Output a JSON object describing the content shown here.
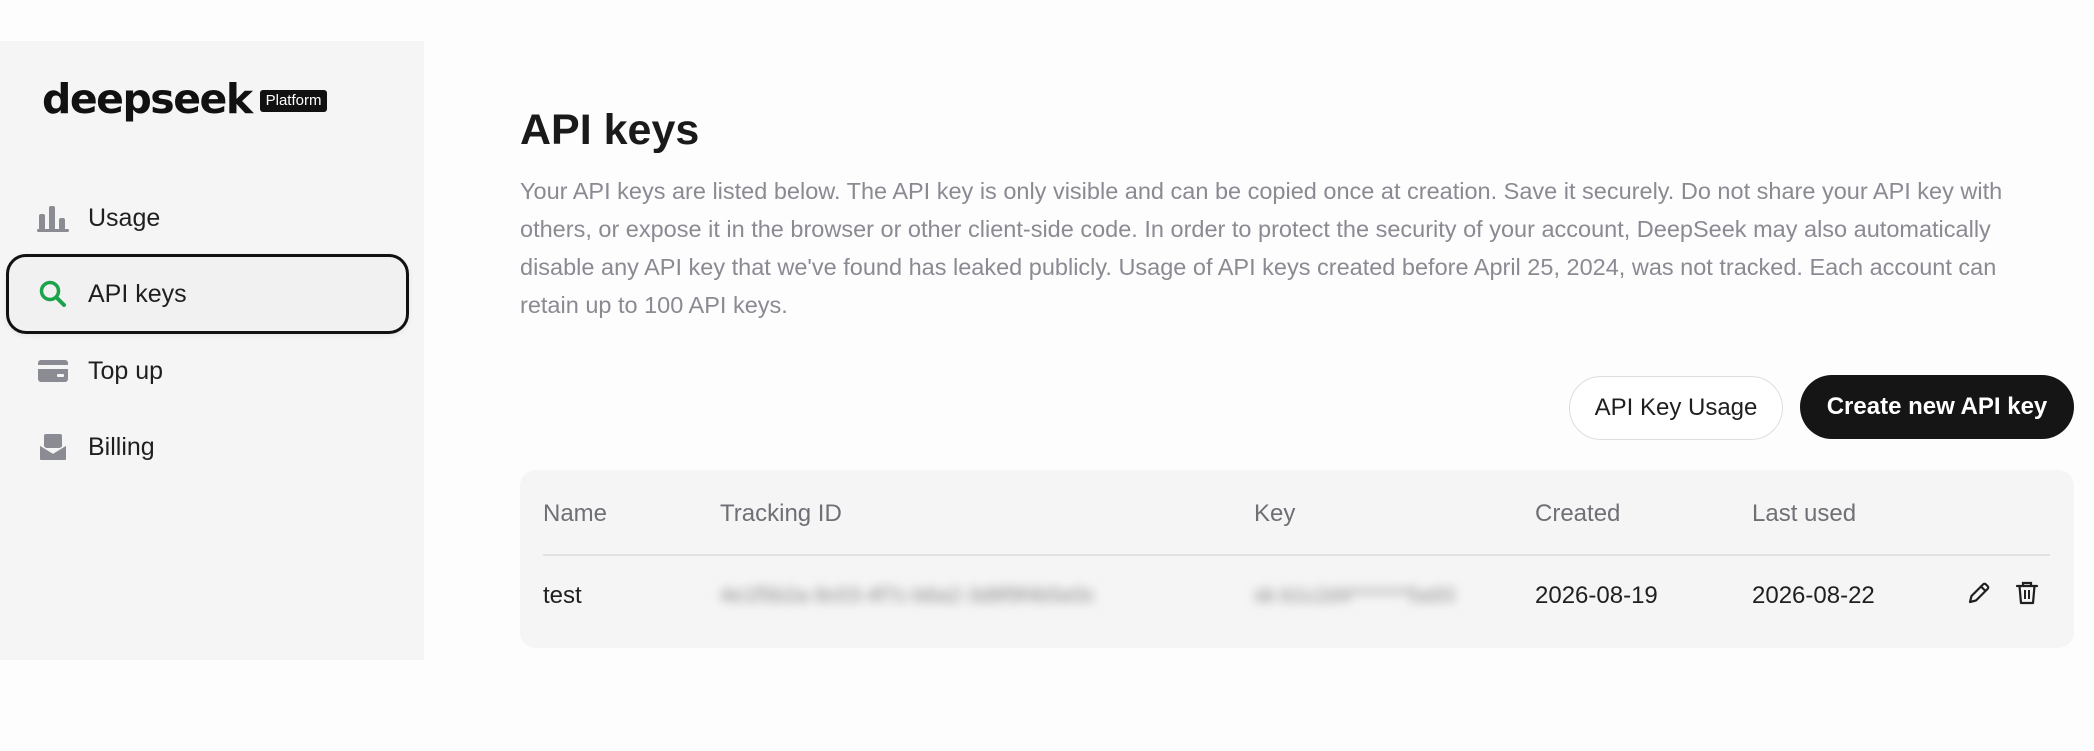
{
  "brand": {
    "name": "deepseek",
    "badge": "Platform"
  },
  "sidebar": {
    "items": [
      {
        "label": "Usage",
        "icon": "bar-chart-icon",
        "active": false
      },
      {
        "label": "API keys",
        "icon": "search-key-icon",
        "active": true
      },
      {
        "label": "Top up",
        "icon": "card-icon",
        "active": false
      },
      {
        "label": "Billing",
        "icon": "billing-icon",
        "active": false
      }
    ]
  },
  "main": {
    "title": "API keys",
    "description": "Your API keys are listed below. The API key is only visible and can be copied once at creation. Save it securely. Do not share your API key with others, or expose it in the browser or other client-side code. In order to protect the security of your account, DeepSeek may also automatically disable any API key that we've found has leaked publicly. Usage of API keys created before April 25, 2024, was not tracked. Each account can retain up to 100 API keys.",
    "buttons": {
      "usage": "API Key Usage",
      "create": "Create new API key"
    },
    "table": {
      "headers": {
        "name": "Name",
        "tracking_id": "Tracking ID",
        "key": "Key",
        "created": "Created",
        "last_used": "Last used"
      },
      "rows": [
        {
          "name": "test",
          "tracking_id": "4e1f5b2a-9c03-4f7c-b6a2-3d8f9f4b5e0c",
          "key": "sk-b1c2d4*******5a93",
          "created": "2026-08-19",
          "last_used": "2026-08-22"
        }
      ]
    }
  },
  "colors": {
    "accent": "#1aa34a",
    "primary": "#151515",
    "muted": "#8a8a93"
  }
}
